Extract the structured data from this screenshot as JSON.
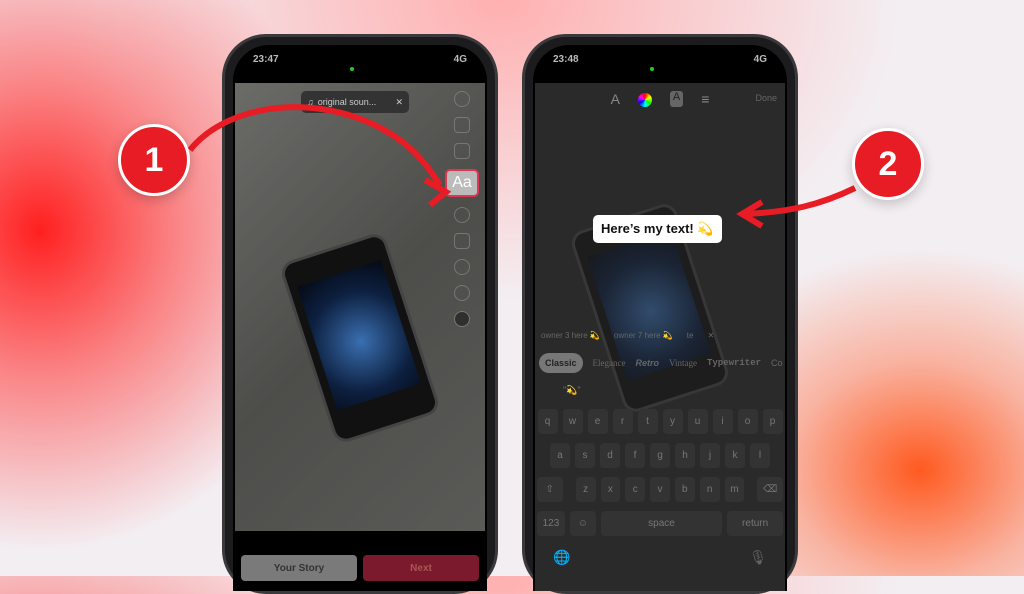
{
  "left": {
    "time": "23:47",
    "network": "4G",
    "sound_label": "original soun...",
    "text_tool": "Aa",
    "your_story": "Your Story",
    "next": "Next"
  },
  "right": {
    "time": "23:48",
    "network": "4G",
    "done": "Done",
    "text": "Here’s my text! 💫",
    "mentions": [
      "owner 3 here 💫",
      "owner 7 here 💫",
      "te"
    ],
    "fonts": [
      "Classic",
      "Elegance",
      "Retro",
      "Vintage",
      "Typewriter",
      "Co"
    ],
    "suggestion": "\"💫\"",
    "keys": {
      "row1": [
        "q",
        "w",
        "e",
        "r",
        "t",
        "y",
        "u",
        "i",
        "o",
        "p"
      ],
      "row2": [
        "a",
        "s",
        "d",
        "f",
        "g",
        "h",
        "j",
        "k",
        "l"
      ],
      "row3": [
        "z",
        "x",
        "c",
        "v",
        "b",
        "n",
        "m"
      ],
      "num": "123",
      "space": "space",
      "return": "return"
    }
  },
  "steps": [
    "1",
    "2"
  ],
  "colors": {
    "accent": "#e81c24",
    "highlight": "#e23455"
  }
}
